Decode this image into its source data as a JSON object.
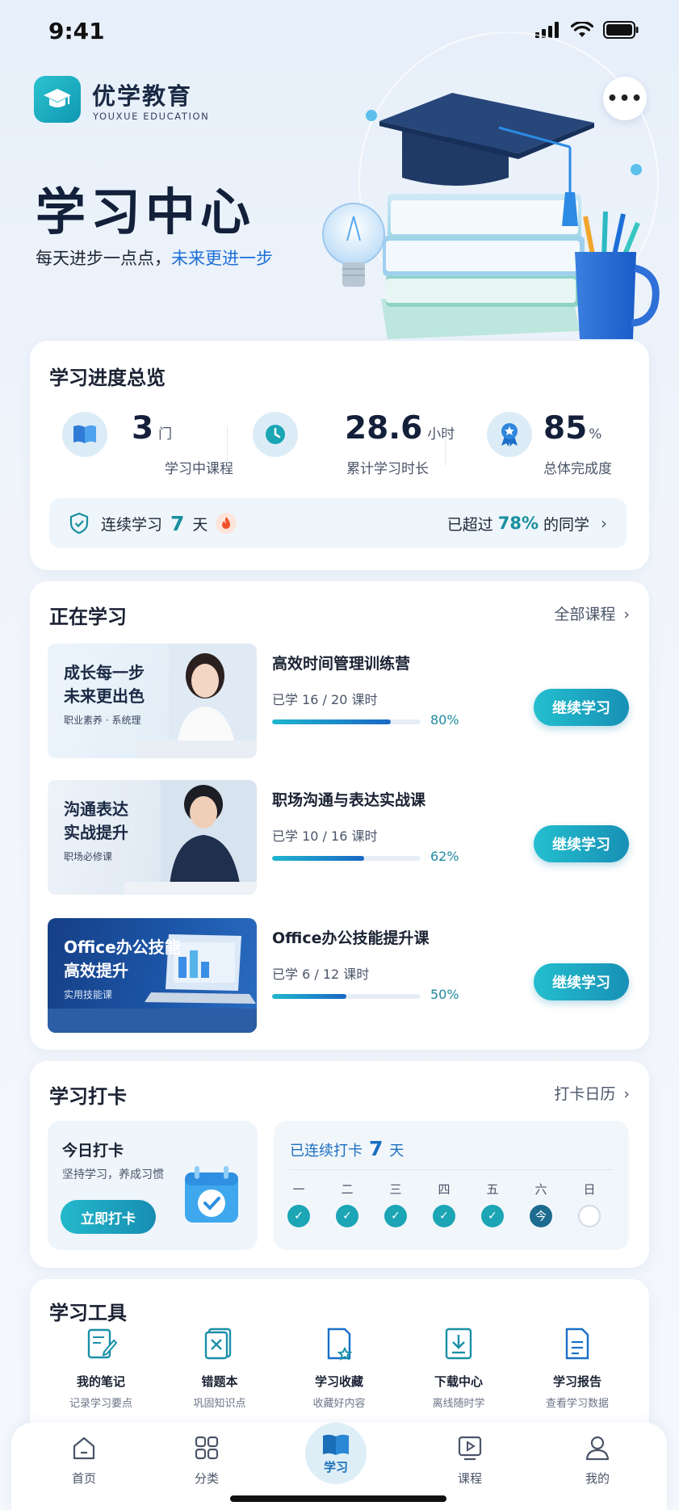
{
  "status_bar": {
    "time": "9:41"
  },
  "brand": {
    "name": "优学教育",
    "english": "YOUXUE EDUCATION"
  },
  "hero": {
    "title": "学习中心",
    "subtitle_prefix": "每天进步一点点，",
    "subtitle_highlight": "未来更进一步"
  },
  "overview": {
    "title": "学习进度总览",
    "stats": [
      {
        "value": "3",
        "unit": "门",
        "label": "学习中课程",
        "icon": "book-icon"
      },
      {
        "value": "28.6",
        "unit": "小时",
        "label": "累计学习时长",
        "icon": "clock-icon"
      },
      {
        "value": "85",
        "unit": "%",
        "label": "总体完成度",
        "icon": "medal-icon"
      }
    ],
    "streak": {
      "prefix": "连续学习",
      "days": "7",
      "suffix": "天",
      "beat_prefix": "已超过",
      "beat_pct": "78%",
      "beat_suffix": "的同学"
    }
  },
  "learning": {
    "title": "正在学习",
    "link": "全部课程",
    "courses": [
      {
        "thumb_title": "成长每一步\n未来更出色",
        "thumb_sub": "职业素养 · 系统理",
        "name": "高效时间管理训练营",
        "progress_text": "已学 16 / 20 课时",
        "progress": 80,
        "pct": "80%",
        "button": "继续学习"
      },
      {
        "thumb_title": "沟通表达\n实战提升",
        "thumb_sub": "职场必修课",
        "name": "职场沟通与表达实战课",
        "progress_text": "已学 10 / 16 课时",
        "progress": 62,
        "pct": "62%",
        "button": "继续学习"
      },
      {
        "thumb_title": "Office办公技能\n高效提升",
        "thumb_sub": "实用技能课",
        "name": "Office办公技能提升课",
        "progress_text": "已学 6 / 12 课时",
        "progress": 50,
        "pct": "50%",
        "button": "继续学习"
      }
    ]
  },
  "checkin": {
    "title": "学习打卡",
    "link": "打卡日历",
    "today_title": "今日打卡",
    "today_sub": "坚持学习，养成习惯",
    "today_button": "立即打卡",
    "streak_prefix": "已连续打卡",
    "streak_days": "7",
    "streak_suffix": "天",
    "days": [
      "一",
      "二",
      "三",
      "四",
      "五",
      "六",
      "日"
    ],
    "today_mark": "今"
  },
  "tools": {
    "title": "学习工具",
    "items": [
      {
        "name": "我的笔记",
        "desc": "记录学习要点"
      },
      {
        "name": "错题本",
        "desc": "巩固知识点"
      },
      {
        "name": "学习收藏",
        "desc": "收藏好内容"
      },
      {
        "name": "下载中心",
        "desc": "离线随时学"
      },
      {
        "name": "学习报告",
        "desc": "查看学习数据"
      }
    ]
  },
  "tabbar": {
    "items": [
      "首页",
      "分类",
      "学习",
      "课程",
      "我的"
    ],
    "active": "学习"
  },
  "colors": {
    "accent": "#1aa3b8",
    "primary_blue": "#1d6fd8"
  }
}
